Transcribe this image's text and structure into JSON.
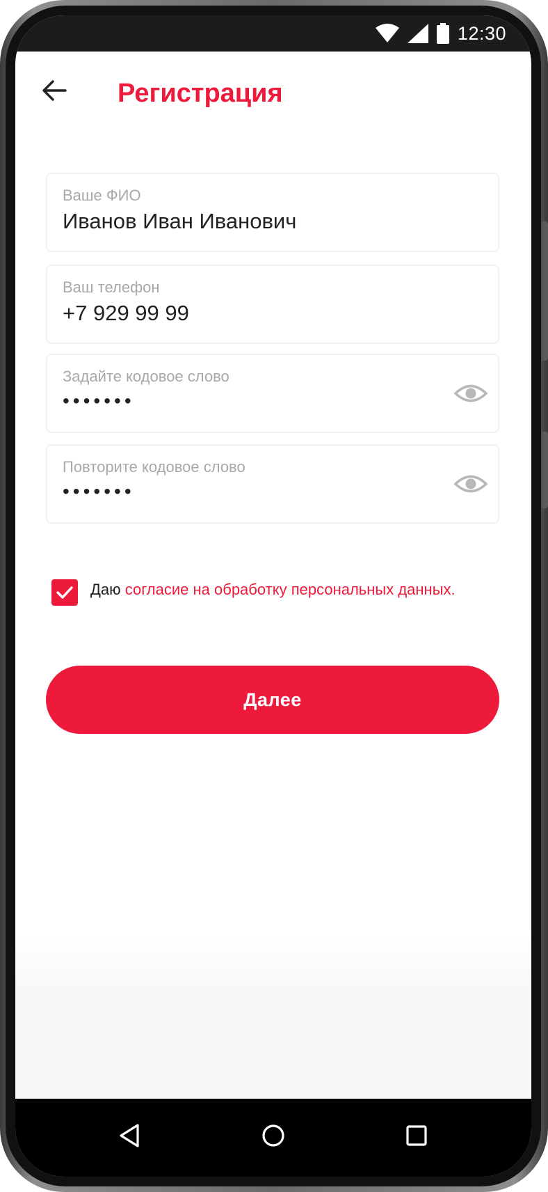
{
  "status_bar": {
    "time": "12:30",
    "icons": [
      "wifi-icon",
      "cellular-signal-icon",
      "battery-icon"
    ]
  },
  "header": {
    "title": "Регистрация",
    "back_icon": "arrow-left-icon"
  },
  "form": {
    "fio": {
      "label": "Ваше ФИО",
      "value": "Иванов Иван Иванович"
    },
    "phone": {
      "label": "Ваш телефон",
      "value": "+7 929 99 99"
    },
    "code_word": {
      "label": "Задайте кодовое слово",
      "value": "•••••••",
      "icon": "eye-icon"
    },
    "code_word_repeat": {
      "label": "Повторите кодовое слово",
      "value": "•••••••",
      "icon": "eye-icon"
    }
  },
  "consent": {
    "checked": true,
    "prefix": "Даю ",
    "link_text": "согласие на обработку персональных данных."
  },
  "actions": {
    "next_label": "Далее"
  },
  "nav_bar": {
    "icons": [
      "nav-back-icon",
      "nav-home-icon",
      "nav-recent-icon"
    ]
  },
  "colors": {
    "accent": "#ee1a3c",
    "label_gray": "#a8a8a8",
    "text_dark": "#222222"
  }
}
